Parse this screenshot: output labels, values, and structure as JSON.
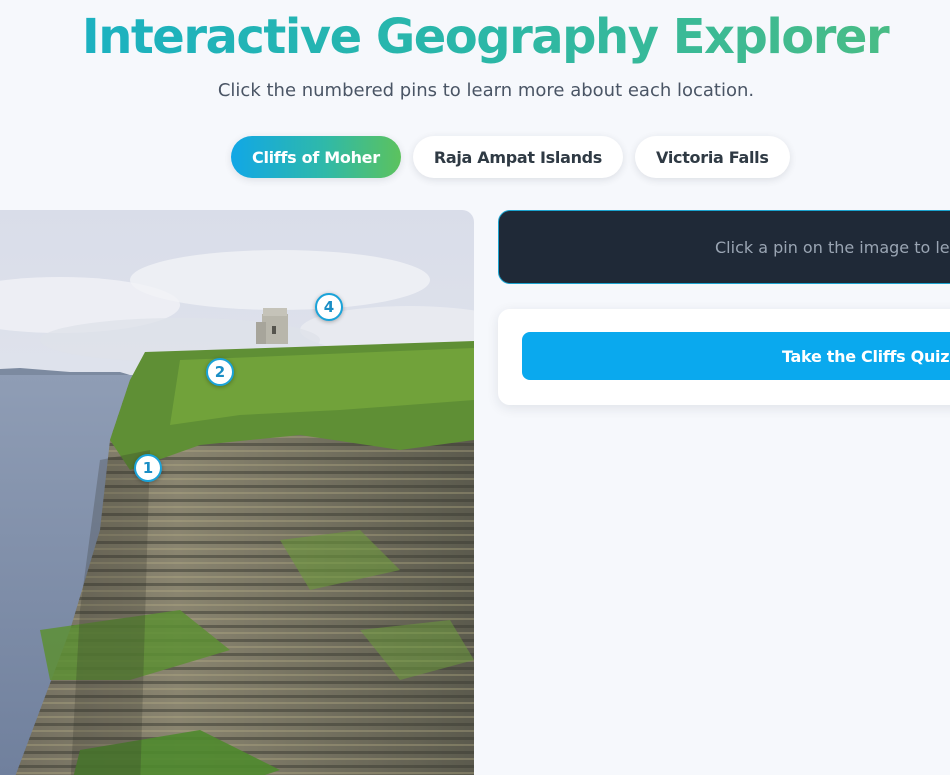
{
  "header": {
    "title": "Interactive Geography Explorer",
    "subtitle": "Click the numbered pins to learn more about each location."
  },
  "tabs": [
    {
      "label": "Cliffs of Moher",
      "active": true
    },
    {
      "label": "Raja Ampat Islands",
      "active": false
    },
    {
      "label": "Victoria Falls",
      "active": false
    }
  ],
  "image": {
    "pins": [
      {
        "label": "1"
      },
      {
        "label": "2"
      },
      {
        "label": "4"
      }
    ]
  },
  "info": {
    "text": "Click a pin on the image to learn"
  },
  "quiz": {
    "button_label": "Take the Cliffs Quiz!"
  },
  "colors": {
    "accent_blue": "#0aa9ee",
    "accent_green": "#5cc25e",
    "info_bg": "#1f2937"
  }
}
